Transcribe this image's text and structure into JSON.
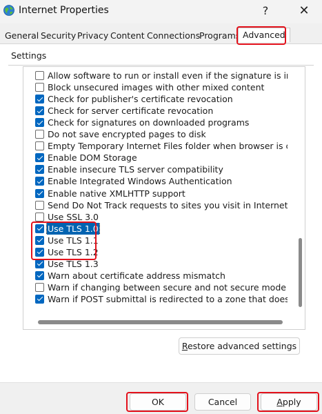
{
  "window": {
    "title": "Internet Properties",
    "help_glyph": "?",
    "close_glyph": "✕"
  },
  "tabs": [
    {
      "label": "General"
    },
    {
      "label": "Security"
    },
    {
      "label": "Privacy"
    },
    {
      "label": "Content"
    },
    {
      "label": "Connections"
    },
    {
      "label": "Programs"
    },
    {
      "label": "Advanced",
      "selected": true
    }
  ],
  "settings": {
    "group_label": "Settings",
    "items": [
      {
        "label": "Allow software to run or install even if the signature is invalid",
        "checked": false
      },
      {
        "label": "Block unsecured images with other mixed content",
        "checked": false
      },
      {
        "label": "Check for publisher's certificate revocation",
        "checked": true
      },
      {
        "label": "Check for server certificate revocation",
        "checked": true
      },
      {
        "label": "Check for signatures on downloaded programs",
        "checked": true
      },
      {
        "label": "Do not save encrypted pages to disk",
        "checked": false
      },
      {
        "label": "Empty Temporary Internet Files folder when browser is closed",
        "checked": false
      },
      {
        "label": "Enable DOM Storage",
        "checked": true
      },
      {
        "label": "Enable insecure TLS server compatibility",
        "checked": true
      },
      {
        "label": "Enable Integrated Windows Authentication",
        "checked": true
      },
      {
        "label": "Enable native XMLHTTP support",
        "checked": true
      },
      {
        "label": "Send Do Not Track requests to sites you visit in Internet Explorer",
        "checked": false
      },
      {
        "label": "Use SSL 3.0",
        "checked": false
      },
      {
        "label": "Use TLS 1.0",
        "checked": true,
        "selected": true
      },
      {
        "label": "Use TLS 1.1",
        "checked": true
      },
      {
        "label": "Use TLS 1.2",
        "checked": true
      },
      {
        "label": "Use TLS 1.3",
        "checked": true
      },
      {
        "label": "Warn about certificate address mismatch",
        "checked": true
      },
      {
        "label": "Warn if changing between secure and not secure mode",
        "checked": false
      },
      {
        "label": "Warn if POST submittal is redirected to a zone that does not permit posts",
        "checked": true
      }
    ]
  },
  "buttons": {
    "restore_mnemonic": "R",
    "restore_rest": "estore advanced settings",
    "ok": "OK",
    "cancel": "Cancel",
    "apply_mnemonic": "A",
    "apply_rest": "pply"
  },
  "colors": {
    "accent": "#0067c0",
    "highlight_annotation": "#e3111b",
    "selection": "#0063b1"
  }
}
